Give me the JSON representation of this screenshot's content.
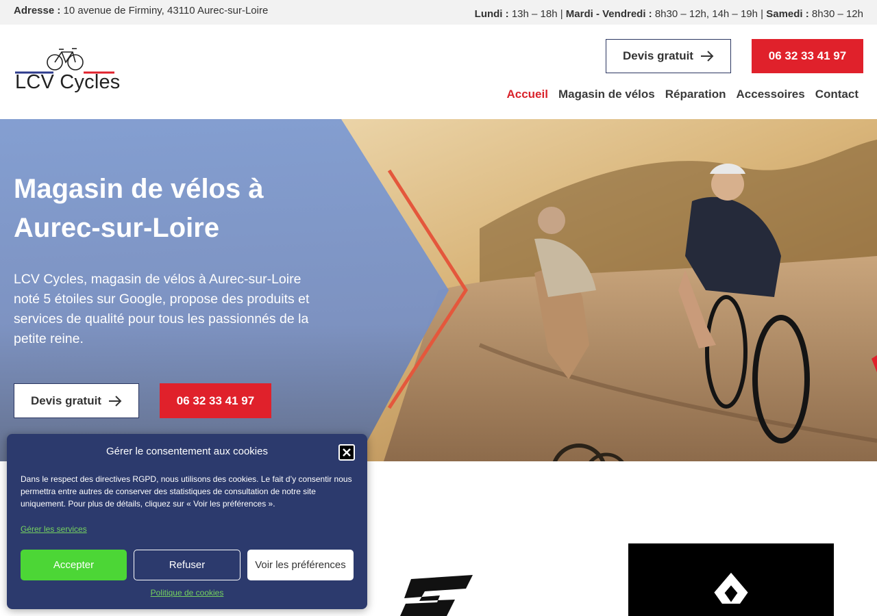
{
  "topbar": {
    "address_label": "Adresse :",
    "address_value": "10 avenue de Firminy, 43110 Aurec-sur-Loire",
    "hours": [
      {
        "label": "Lundi :",
        "value": "13h – 18h"
      },
      {
        "label": "Mardi - Vendredi :",
        "value": "8h30 – 12h, 14h – 19h"
      },
      {
        "label": "Samedi :",
        "value": "8h30 – 12h"
      }
    ],
    "separator": "|"
  },
  "header": {
    "logo_text": "LCV Cycles",
    "quote_button": "Devis gratuit",
    "phone_button": "06 32 33 41 97",
    "nav": [
      "Accueil",
      "Magasin de vélos",
      "Réparation",
      "Accessoires",
      "Contact"
    ]
  },
  "hero": {
    "title": "Magasin de vélos à Aurec-sur-Loire",
    "lead": "LCV Cycles, magasin de vélos à Aurec-sur-Loire noté 5 étoiles sur Google, propose des produits et services de qualité pour tous les passionnés de la petite reine.",
    "quote_button": "Devis gratuit",
    "phone_button": "06 32 33 41 97"
  },
  "cookie": {
    "title": "Gérer le consentement aux cookies",
    "text": "Dans le respect des directives RGPD, nous utilisons des cookies. Le fait d’y consentir nous permettra entre autres de conserver des statistiques de consultation de notre site uniquement. Pour plus de détails, cliquez sur « Voir les préférences ».",
    "manage_link": "Gérer les services",
    "accept": "Accepter",
    "refuse": "Refuser",
    "preferences": "Voir les préférences",
    "policy_link": "Politique de cookies"
  },
  "colors": {
    "brand_red": "#e0212b",
    "navy": "#2c3a6d",
    "accept_green": "#4cd636",
    "link_green": "#76d35f"
  },
  "icons": [
    "arrow-right-icon",
    "bike-icon",
    "close-icon"
  ]
}
